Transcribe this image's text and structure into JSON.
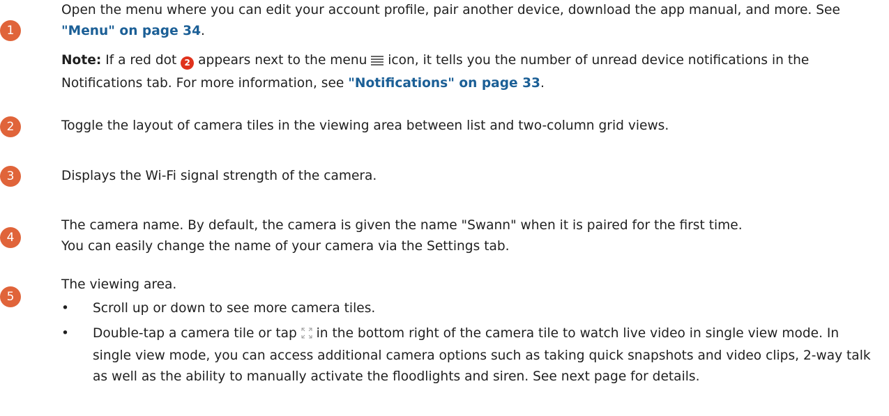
{
  "items": [
    {
      "number": "1",
      "text_pre": "Open the menu where you can edit your account profile, pair another device, download the app manual, and more. See ",
      "link": "\"Menu\" on page 34",
      "text_post": ".",
      "note": {
        "label": "Note:",
        "t1": " If a red dot ",
        "badge": "2",
        "t2": " appears next to the menu ",
        "t3": " icon, it tells you the number of unread device notifications in the ",
        "ui": "Notifications",
        "t4": " tab. For more information, see ",
        "link": "\"Notifications\" on page 33",
        "t5": "."
      }
    },
    {
      "number": "2",
      "text": "Toggle the layout of camera tiles in the viewing area between list and two-column grid views."
    },
    {
      "number": "3",
      "text": "Displays the Wi-Fi signal strength of the camera."
    },
    {
      "number": "4",
      "line1": "The camera name. By default, the camera is given the name \"Swann\" when it is paired for the first time.",
      "line2_pre": "You can easily change the name of your camera  via the ",
      "ui": "Settings",
      "line2_post": " tab."
    },
    {
      "number": "5",
      "intro": "The viewing area.",
      "bullet_char": "•",
      "bullet1": "Scroll up or down to see more camera tiles.",
      "bullet2_pre": "Double-tap a camera tile or tap ",
      "bullet2_post": " in the bottom right of the camera tile to watch live video in single view mode. In single view mode, you can access additional camera options such as taking quick snapshots and video clips, 2-way talk as well as the ability to manually activate the floodlights and siren. See next page for details."
    }
  ],
  "colors": {
    "circle": "#e0643a",
    "link": "#1b5f96",
    "red_dot": "#e0321c"
  },
  "icons": [
    "menu-icon",
    "fullscreen-icon"
  ]
}
